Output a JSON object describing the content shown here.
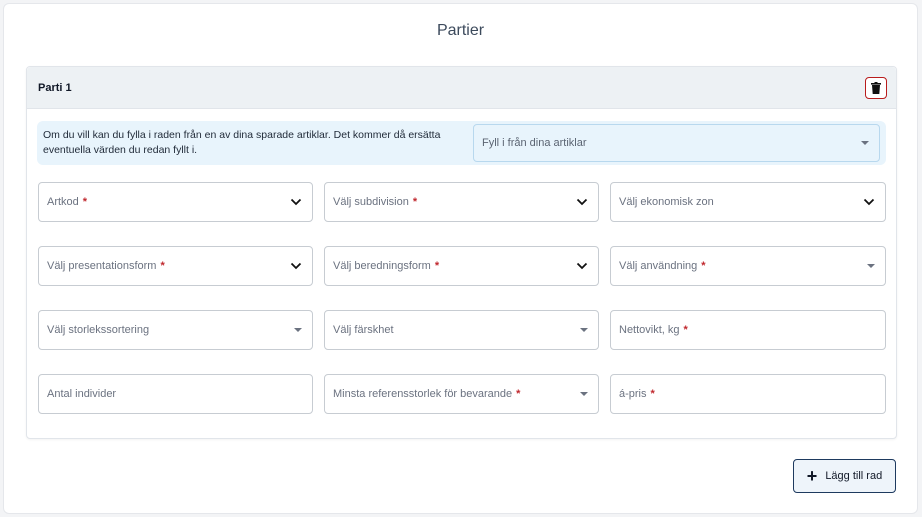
{
  "page": {
    "title": "Partier"
  },
  "parti": {
    "title": "Parti 1",
    "delete_icon": "trash-icon",
    "prefill": {
      "text": "Om du vill kan du fylla i raden från en av dina sparade artiklar. Det kommer då ersätta eventuella värden du redan fyllt i.",
      "select_placeholder": "Fyll i från dina artiklar"
    },
    "fields": [
      {
        "name": "artkod-select",
        "label": "Artkod",
        "required": "*",
        "icon": "chevron"
      },
      {
        "name": "subdivision-select",
        "label": "Välj subdivision",
        "required": "*",
        "icon": "chevron"
      },
      {
        "name": "ekonomisk-zon-select",
        "label": "Välj ekonomisk zon",
        "required": "",
        "icon": "chevron"
      },
      {
        "name": "presentationsform-select",
        "label": "Välj presentationsform",
        "required": "*",
        "icon": "chevron"
      },
      {
        "name": "beredningsform-select",
        "label": "Välj beredningsform",
        "required": "*",
        "icon": "chevron"
      },
      {
        "name": "anvandning-select",
        "label": "Välj användning",
        "required": "*",
        "icon": "caret"
      },
      {
        "name": "storlekssortering-select",
        "label": "Välj storlekssortering",
        "required": "",
        "icon": "caret"
      },
      {
        "name": "farskhet-select",
        "label": "Välj färskhet",
        "required": "",
        "icon": "caret"
      },
      {
        "name": "nettovikt-input",
        "label": "Nettovikt, kg",
        "required": "*",
        "icon": ""
      },
      {
        "name": "antal-individer-input",
        "label": "Antal individer",
        "required": "",
        "icon": ""
      },
      {
        "name": "minsta-referensstorlek-select",
        "label": "Minsta referensstorlek för bevarande",
        "required": "*",
        "icon": "caret"
      },
      {
        "name": "a-pris-input",
        "label": "á-pris",
        "required": "*",
        "icon": ""
      }
    ]
  },
  "actions": {
    "add_row_label": "Lägg till rad",
    "add_icon": "plus-icon"
  },
  "colors": {
    "required": "#c0272d",
    "delete_border": "#b91c1c",
    "add_border": "#1e3a5f",
    "info_bg": "#e8f4fc"
  }
}
